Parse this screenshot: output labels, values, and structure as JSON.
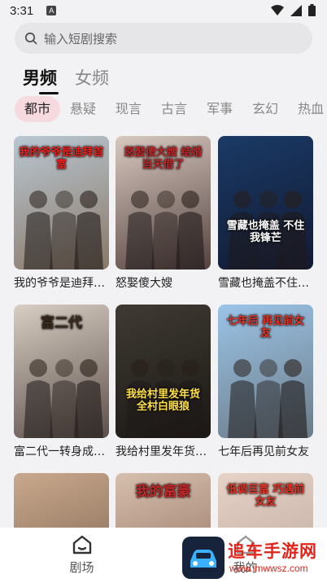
{
  "status_bar": {
    "time": "3:31",
    "notification_badge": "A"
  },
  "search": {
    "placeholder": "输入短剧搜索"
  },
  "gender_tabs": [
    {
      "label": "男频",
      "active": true
    },
    {
      "label": "女频",
      "active": false
    }
  ],
  "categories": [
    {
      "label": "都市",
      "active": true
    },
    {
      "label": "悬疑",
      "active": false
    },
    {
      "label": "现言",
      "active": false
    },
    {
      "label": "古言",
      "active": false
    },
    {
      "label": "军事",
      "active": false
    },
    {
      "label": "玄幻",
      "active": false
    },
    {
      "label": "热血",
      "active": false
    }
  ],
  "dramas": [
    {
      "title": "我的爷爷是迪拜首富",
      "poster_text": "我的爷爷是迪拜首富",
      "colors": [
        "#b9c7d3",
        "#8a7866"
      ],
      "text_color": "#e8231f"
    },
    {
      "title": "怒娶傻大嫂",
      "poster_text": "怒娶傻大嫂 结婚当天借了",
      "colors": [
        "#d8c9c0",
        "#54423f"
      ],
      "text_color": "#c0282a"
    },
    {
      "title": "雪藏也掩盖不住锋芒",
      "poster_text": "雪藏也掩盖 不住我锋芒",
      "colors": [
        "#1a3a66",
        "#121a33"
      ],
      "text_color": "#ffffff"
    },
    {
      "title": "富二代一转身成为大佬",
      "poster_text": "富二代",
      "colors": [
        "#d8cec3",
        "#5c4f49"
      ],
      "text_color": "#3a2a1e"
    },
    {
      "title": "我给村里发年货全村白眼狼",
      "poster_text": "我给村里发年货 全村白眼狼",
      "colors": [
        "#3f3a33",
        "#1b1814"
      ],
      "text_color": "#ffe04a"
    },
    {
      "title": "七年后再见前女友",
      "poster_text": "七年后 再见前女友",
      "colors": [
        "#9bc4e8",
        "#6c7b86"
      ],
      "text_color": "#e33629"
    },
    {
      "title": "",
      "poster_text": "",
      "colors": [
        "#c8a98d",
        "#7b5e4c"
      ],
      "text_color": "#ffffff"
    },
    {
      "title": "",
      "poster_text": "我的富豪",
      "colors": [
        "#d6bfae",
        "#8e6a5a"
      ],
      "text_color": "#c0282a"
    },
    {
      "title": "",
      "poster_text": "低调巨富 巧遇前女友",
      "colors": [
        "#e6d2c6",
        "#b8a59a"
      ],
      "text_color": "#e33629"
    }
  ],
  "bottom_nav": [
    {
      "label": "剧场",
      "icon": "home-icon"
    },
    {
      "label": "我的",
      "icon": "person-icon"
    }
  ],
  "watermark": {
    "text": "追车手游网",
    "url": "www.lmwwsz.com"
  },
  "colors": {
    "accent_pill": "#f6dadf",
    "background": "#f2f2f4",
    "watermark_red": "#e2231a"
  }
}
